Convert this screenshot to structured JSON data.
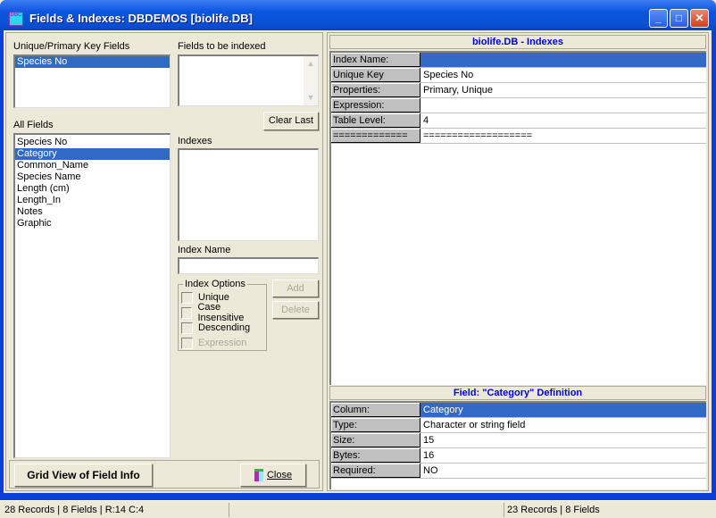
{
  "window": {
    "title": "Fields & Indexes: DBDEMOS [biolife.DB]",
    "icon_text": "DBC",
    "controls": {
      "minimize": "_",
      "maximize": "□",
      "close": "✕"
    }
  },
  "left": {
    "unique_label": "Unique/Primary Key Fields",
    "unique_items": [
      "Species No"
    ],
    "unique_selected": 0,
    "to_index_label": "Fields to be indexed",
    "to_index_items": [],
    "clear_last_label": "Clear Last",
    "all_fields_label": "All Fields",
    "all_fields": [
      "Species No",
      "Category",
      "Common_Name",
      "Species Name",
      "Length (cm)",
      "Length_In",
      "Notes",
      "Graphic"
    ],
    "all_fields_selected": 1,
    "indexes_label": "Indexes",
    "index_name_label": "Index Name",
    "index_name_value": "",
    "index_options_label": "Index Options",
    "options": [
      {
        "label": "Unique",
        "checked": false,
        "enabled": true
      },
      {
        "label": "Case Insensitive",
        "checked": false,
        "enabled": true
      },
      {
        "label": "Descending",
        "checked": false,
        "enabled": true
      },
      {
        "label": "Expression",
        "checked": false,
        "enabled": false
      }
    ],
    "add_label": "Add",
    "delete_label": "Delete",
    "grid_view_label": "Grid View of Field Info",
    "close_label": "Close"
  },
  "right": {
    "indexes_title": "biolife.DB - Indexes",
    "index_rows": [
      {
        "key": "Index Name:",
        "value": ""
      },
      {
        "key": "Unique Key Field(s):",
        "value": "Species No"
      },
      {
        "key": "Properties:",
        "value": "Primary, Unique"
      },
      {
        "key": "Expression:",
        "value": ""
      },
      {
        "key": "Table Level:",
        "value": "4"
      },
      {
        "key": " =============",
        "value": "==================="
      }
    ],
    "field_title": "Field: \"Category\" Definition",
    "field_rows": [
      {
        "key": "Column:",
        "value": "Category"
      },
      {
        "key": "Type:",
        "value": "Character or string field"
      },
      {
        "key": "Size:",
        "value": "15"
      },
      {
        "key": "Bytes:",
        "value": "16"
      },
      {
        "key": "Required:",
        "value": "NO"
      }
    ]
  },
  "status": {
    "left": "28 Records | 8 Fields | R:14 C:4",
    "middle": "",
    "right": "23 Records | 8 Fields"
  }
}
